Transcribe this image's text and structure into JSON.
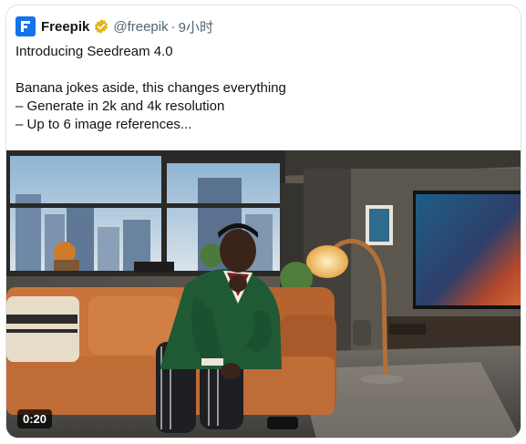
{
  "tweet": {
    "author_name": "Freepik",
    "handle": "@freepik",
    "separator": "·",
    "time": "9小时",
    "text_lines": [
      "Introducing Seedream 4.0",
      "",
      "Banana jokes aside, this changes everything",
      "– Generate in 2k and 4k resolution",
      "– Up to 6 image references..."
    ]
  },
  "video": {
    "duration": "0:20"
  },
  "colors": {
    "brand": "#1273eb",
    "verified": "#e2b719",
    "sofa": "#c26a33",
    "sweater": "#1f5a34"
  }
}
